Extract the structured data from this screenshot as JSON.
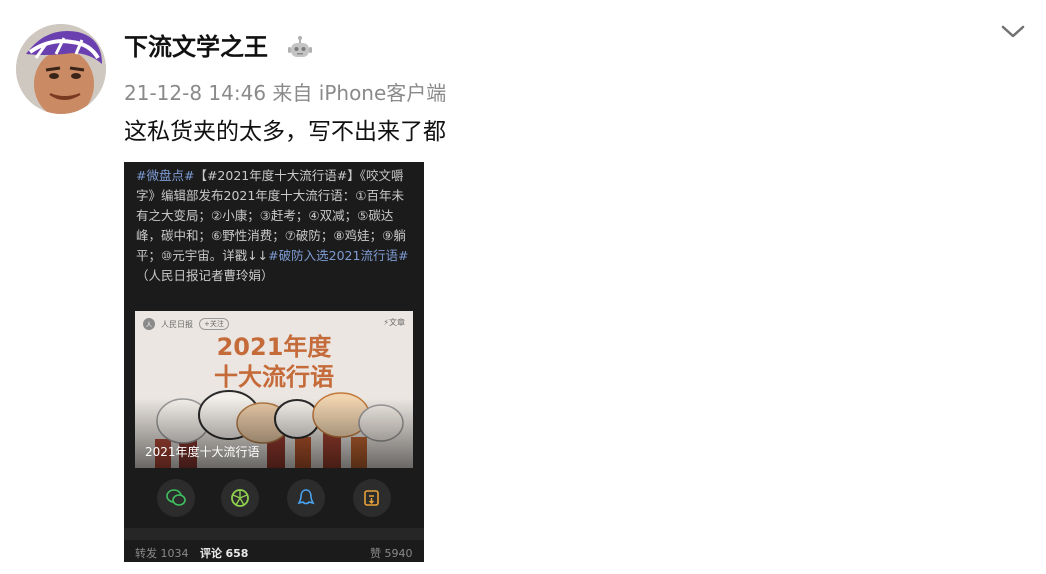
{
  "post": {
    "username": "下流文学之王",
    "badge_icon": "robot-icon",
    "timestamp": "21-12-8 14:46",
    "source": "来自 iPhone客户端",
    "text": "这私货夹的太多，写不出来了都",
    "menu_icon": "chevron-down-icon"
  },
  "screenshot": {
    "hashtag1": "#微盘点#",
    "hashtag2": "【#2021年度十大流行语#】",
    "body1": "《咬文嚼字》编辑部发布2021年度十大流行语：①百年未有之大变局；②小康；③赶考；④双减；⑤碳达峰，碳中和；⑥野性消费；⑦破防；⑧鸡娃；⑨躺平；⑩元宇宙。详戳↓↓",
    "hashtag3": "#破防入选2021流行语#",
    "body2": "（人民日报记者曹玲娟）",
    "article": {
      "publisher": "人民日报",
      "follow_label": "+关注",
      "kind_label": "⚡文章",
      "title_line1": "2021年度",
      "title_line2": "十大流行语",
      "caption": "2021年度十大流行语"
    },
    "share_icons": [
      "wechat-icon",
      "moments-icon",
      "qq-icon",
      "save-icon"
    ],
    "stats": {
      "repost_label": "转发",
      "repost_count": "1034",
      "comment_label": "评论",
      "comment_count": "658",
      "like_label": "赞",
      "like_count": "5940"
    }
  },
  "colors": {
    "accent_link": "#7d9bd3",
    "title_orange": "#c56b3a",
    "meta_gray": "#8a8a8a"
  }
}
